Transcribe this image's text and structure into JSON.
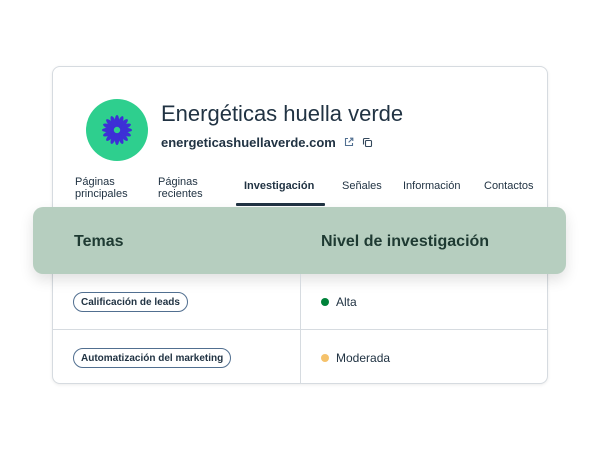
{
  "company": {
    "name": "Energéticas huella verde",
    "domain": "energeticashuellaverde.com"
  },
  "icons": {
    "logo": "flower-icon",
    "external_link": "external-link-icon",
    "copy": "copy-icon"
  },
  "tabs": [
    {
      "label": "Páginas principales",
      "line1": "Páginas",
      "line2": "principales"
    },
    {
      "label": "Páginas recientes",
      "line1": "Páginas",
      "line2": "recientes"
    },
    {
      "label": "Investigación",
      "active": true
    },
    {
      "label": "Señales"
    },
    {
      "label": "Información"
    },
    {
      "label": "Contactos"
    }
  ],
  "table": {
    "headers": [
      "Temas",
      "Nivel de investigación"
    ],
    "rows": [
      {
        "topic": "Calificación de leads",
        "level": "Alta",
        "level_color": "#00823a"
      },
      {
        "topic": "Automatización del marketing",
        "level": "Moderada",
        "level_color": "#f5c26b"
      }
    ]
  },
  "colors": {
    "logo_bg": "#2ecf8e",
    "logo_petals": "#3d2fd6",
    "header_band": "#b6cebf",
    "text": "#213343"
  }
}
